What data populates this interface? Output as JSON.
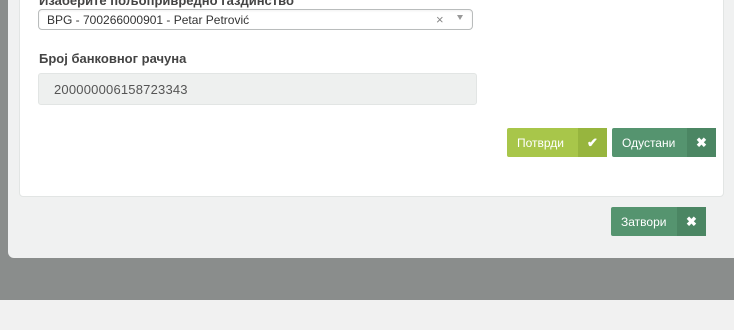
{
  "form": {
    "farm_label": "Изаберите пољопривредно газдинство",
    "farm_select_value": "BPG - 700266000901 - Petar Petrović",
    "clear_symbol": "×",
    "account_label": "Број банковног рачуна",
    "account_value": "200000006158723343"
  },
  "actions": {
    "confirm_label": "Потврди",
    "confirm_icon": "✔",
    "cancel_label": "Одустани",
    "cancel_icon": "✖"
  },
  "footer": {
    "close_label": "Затвори",
    "close_icon": "✖"
  },
  "colors": {
    "confirm": "#a8c64a",
    "cancel": "#55946f",
    "close": "#55946f"
  }
}
